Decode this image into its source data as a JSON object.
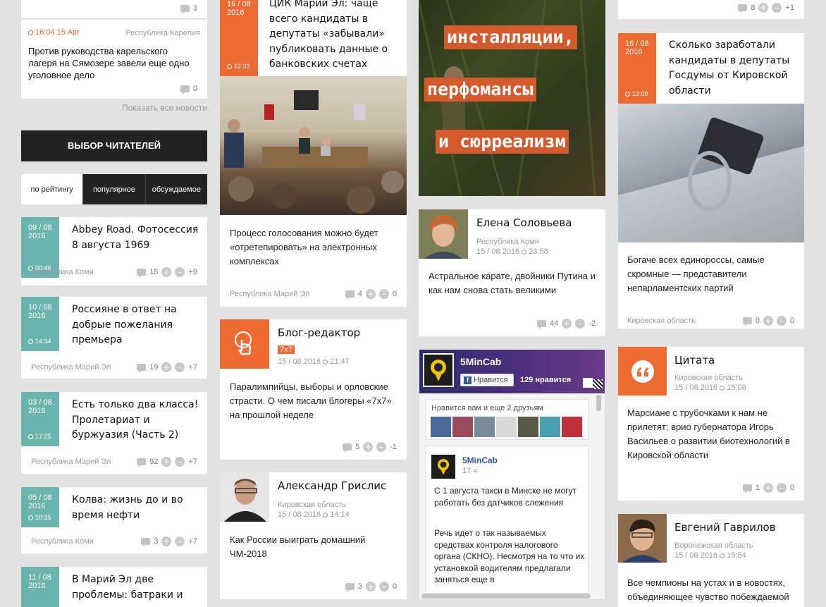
{
  "left": {
    "top_card": {
      "count": "3"
    },
    "news": {
      "date": "16:04 15 Авг",
      "region": "Республика Карелия",
      "title": "Против руководства карельского лагеря на Сямозере завели еще одно уголовное дело",
      "count": "0"
    },
    "show_all": "Показать все новости",
    "readers_choice": "ВЫБОР ЧИТАТЕЛЕЙ",
    "tabs": [
      "по рейтингу",
      "популярное",
      "обсуждаемое"
    ],
    "items": [
      {
        "date": "09 / 08",
        "year": "2016",
        "time": "00:46",
        "title": "Abbey Road. Фотосессия 8 августа 1969",
        "region": "Республика Коми",
        "comments": "15",
        "score": "+9"
      },
      {
        "date": "10 / 08",
        "year": "2016",
        "time": "14:34",
        "title": "Россияне в ответ на добрые пожелания премьера",
        "region": "Республика Марий Эл",
        "comments": "19",
        "score": "+7"
      },
      {
        "date": "03 / 08",
        "year": "2016",
        "time": "17:25",
        "title": "Есть только два класса! Пролетариат и буржуазия (Часть 2)",
        "region": "Республика Марий Эл",
        "comments": "92",
        "score": "+7"
      },
      {
        "date": "05 / 08",
        "year": "2016",
        "time": "10:35",
        "title": "Колва: жизнь до и во время нефти",
        "region": "Республика Коми",
        "comments": "3",
        "score": "+7"
      },
      {
        "date": "11 / 08",
        "year": "2016",
        "time": "",
        "title": "В Марий Эл две проблемы: батраки и",
        "region": "",
        "comments": "",
        "score": ""
      }
    ]
  },
  "col2": {
    "cik": {
      "date": "16 / 08",
      "year": "2016",
      "time": "12:33",
      "title": "ЦИК Марий Эл: чаще всего кандидаты в депутаты «забывали» публиковать данные о банковских счетах",
      "text": "Процесс голосования можно будет «отретепировать» на электронных комплексах",
      "region": "Республика Марий Эл",
      "comments": "4",
      "score": "0"
    },
    "blog": {
      "title": "Блог-редактор",
      "badge": "7x7",
      "date": "15 / 08 2016",
      "time": "21:47",
      "text": "Паралимпийцы, выборы и орловские страсти. О чем писали блогеры «7x7» на прошлой неделе",
      "comments": "5",
      "score": "-1"
    },
    "grislis": {
      "name": "Александр Грислис",
      "region": "Кировская область",
      "date": "15 / 08 2016",
      "time": "14:14",
      "text": "Как России выиграть домашний ЧМ-2018",
      "comments": "3",
      "score": "0"
    }
  },
  "col3": {
    "banner": [
      "инсталляции,",
      "перфомансы",
      "и сюрреализм"
    ],
    "soloveva": {
      "name": "Елена Соловьева",
      "region": "Республика Коми",
      "date": "15 / 08 2016",
      "time": "23:58",
      "text": "Астральное карате, двойники Путина и как нам снова стать великими",
      "comments": "44",
      "score": "-2"
    },
    "fb": {
      "page": "5MinCab",
      "like_btn": "Нравится",
      "likes": "129 нравится",
      "friends": "Нравится вам и еще 2 друзьям",
      "post_name": "5MinCab",
      "post_time": "17 ч",
      "post_title": "С 1 августа такси в Минске не могут работать без датчиков слежения",
      "post_text": "Речь идет о так называемых средствах контроля налогового органа (СКНО). Несмотря на то что их установкой водителям предлагали заняться еще в"
    }
  },
  "col4": {
    "top": {
      "comments": "8",
      "score": "+1"
    },
    "earned": {
      "date": "16 / 08",
      "year": "2016",
      "time": "13:09",
      "title": "Сколько заработали кандидаты в депутаты Госдумы от Кировской области",
      "text": "Богаче всех единороссы, самые скромные — представители непарламентских партий",
      "region": "Кировская область",
      "comments": "0",
      "score": "0"
    },
    "quote": {
      "title": "Цитата",
      "region": "Кировская область",
      "date": "15 / 08 2016",
      "time": "15:08",
      "text": "Марсиане с трубочками к нам не прилетят: врио губернатора Игорь Васильев о развитии биотехнологий в Кировской области",
      "comments": "1",
      "score": "0"
    },
    "gavrilov": {
      "name": "Евгений Гаврилов",
      "region": "Воронежская область",
      "date": "15 / 08 2016",
      "time": "15:54",
      "text": "Все чемпионы на устах и в новостях, объединяющее чувство побеждаемой"
    }
  },
  "colors": {
    "teal": "#6bb5ae",
    "orange": "#ee6a33",
    "dark": "#222222"
  }
}
